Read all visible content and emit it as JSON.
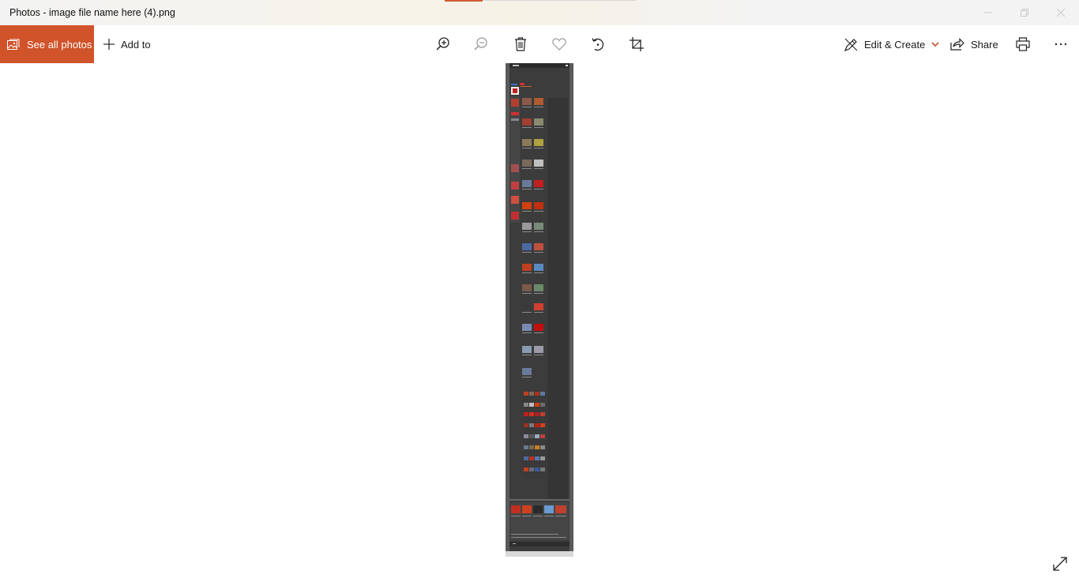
{
  "window": {
    "title": "Photos - image file name here (4).png"
  },
  "toolbar": {
    "see_all_photos_label": "See all photos",
    "add_to_label": "Add to",
    "edit_create_label": "Edit & Create",
    "share_label": "Share",
    "icons": [
      "zoom-in-icon",
      "zoom-out-icon",
      "delete-icon",
      "favorite-icon",
      "rotate-icon",
      "crop-icon",
      "print-icon",
      "more-icon"
    ]
  },
  "colors": {
    "accent": "#d0532a",
    "photo_background": "#4a4a4a"
  }
}
